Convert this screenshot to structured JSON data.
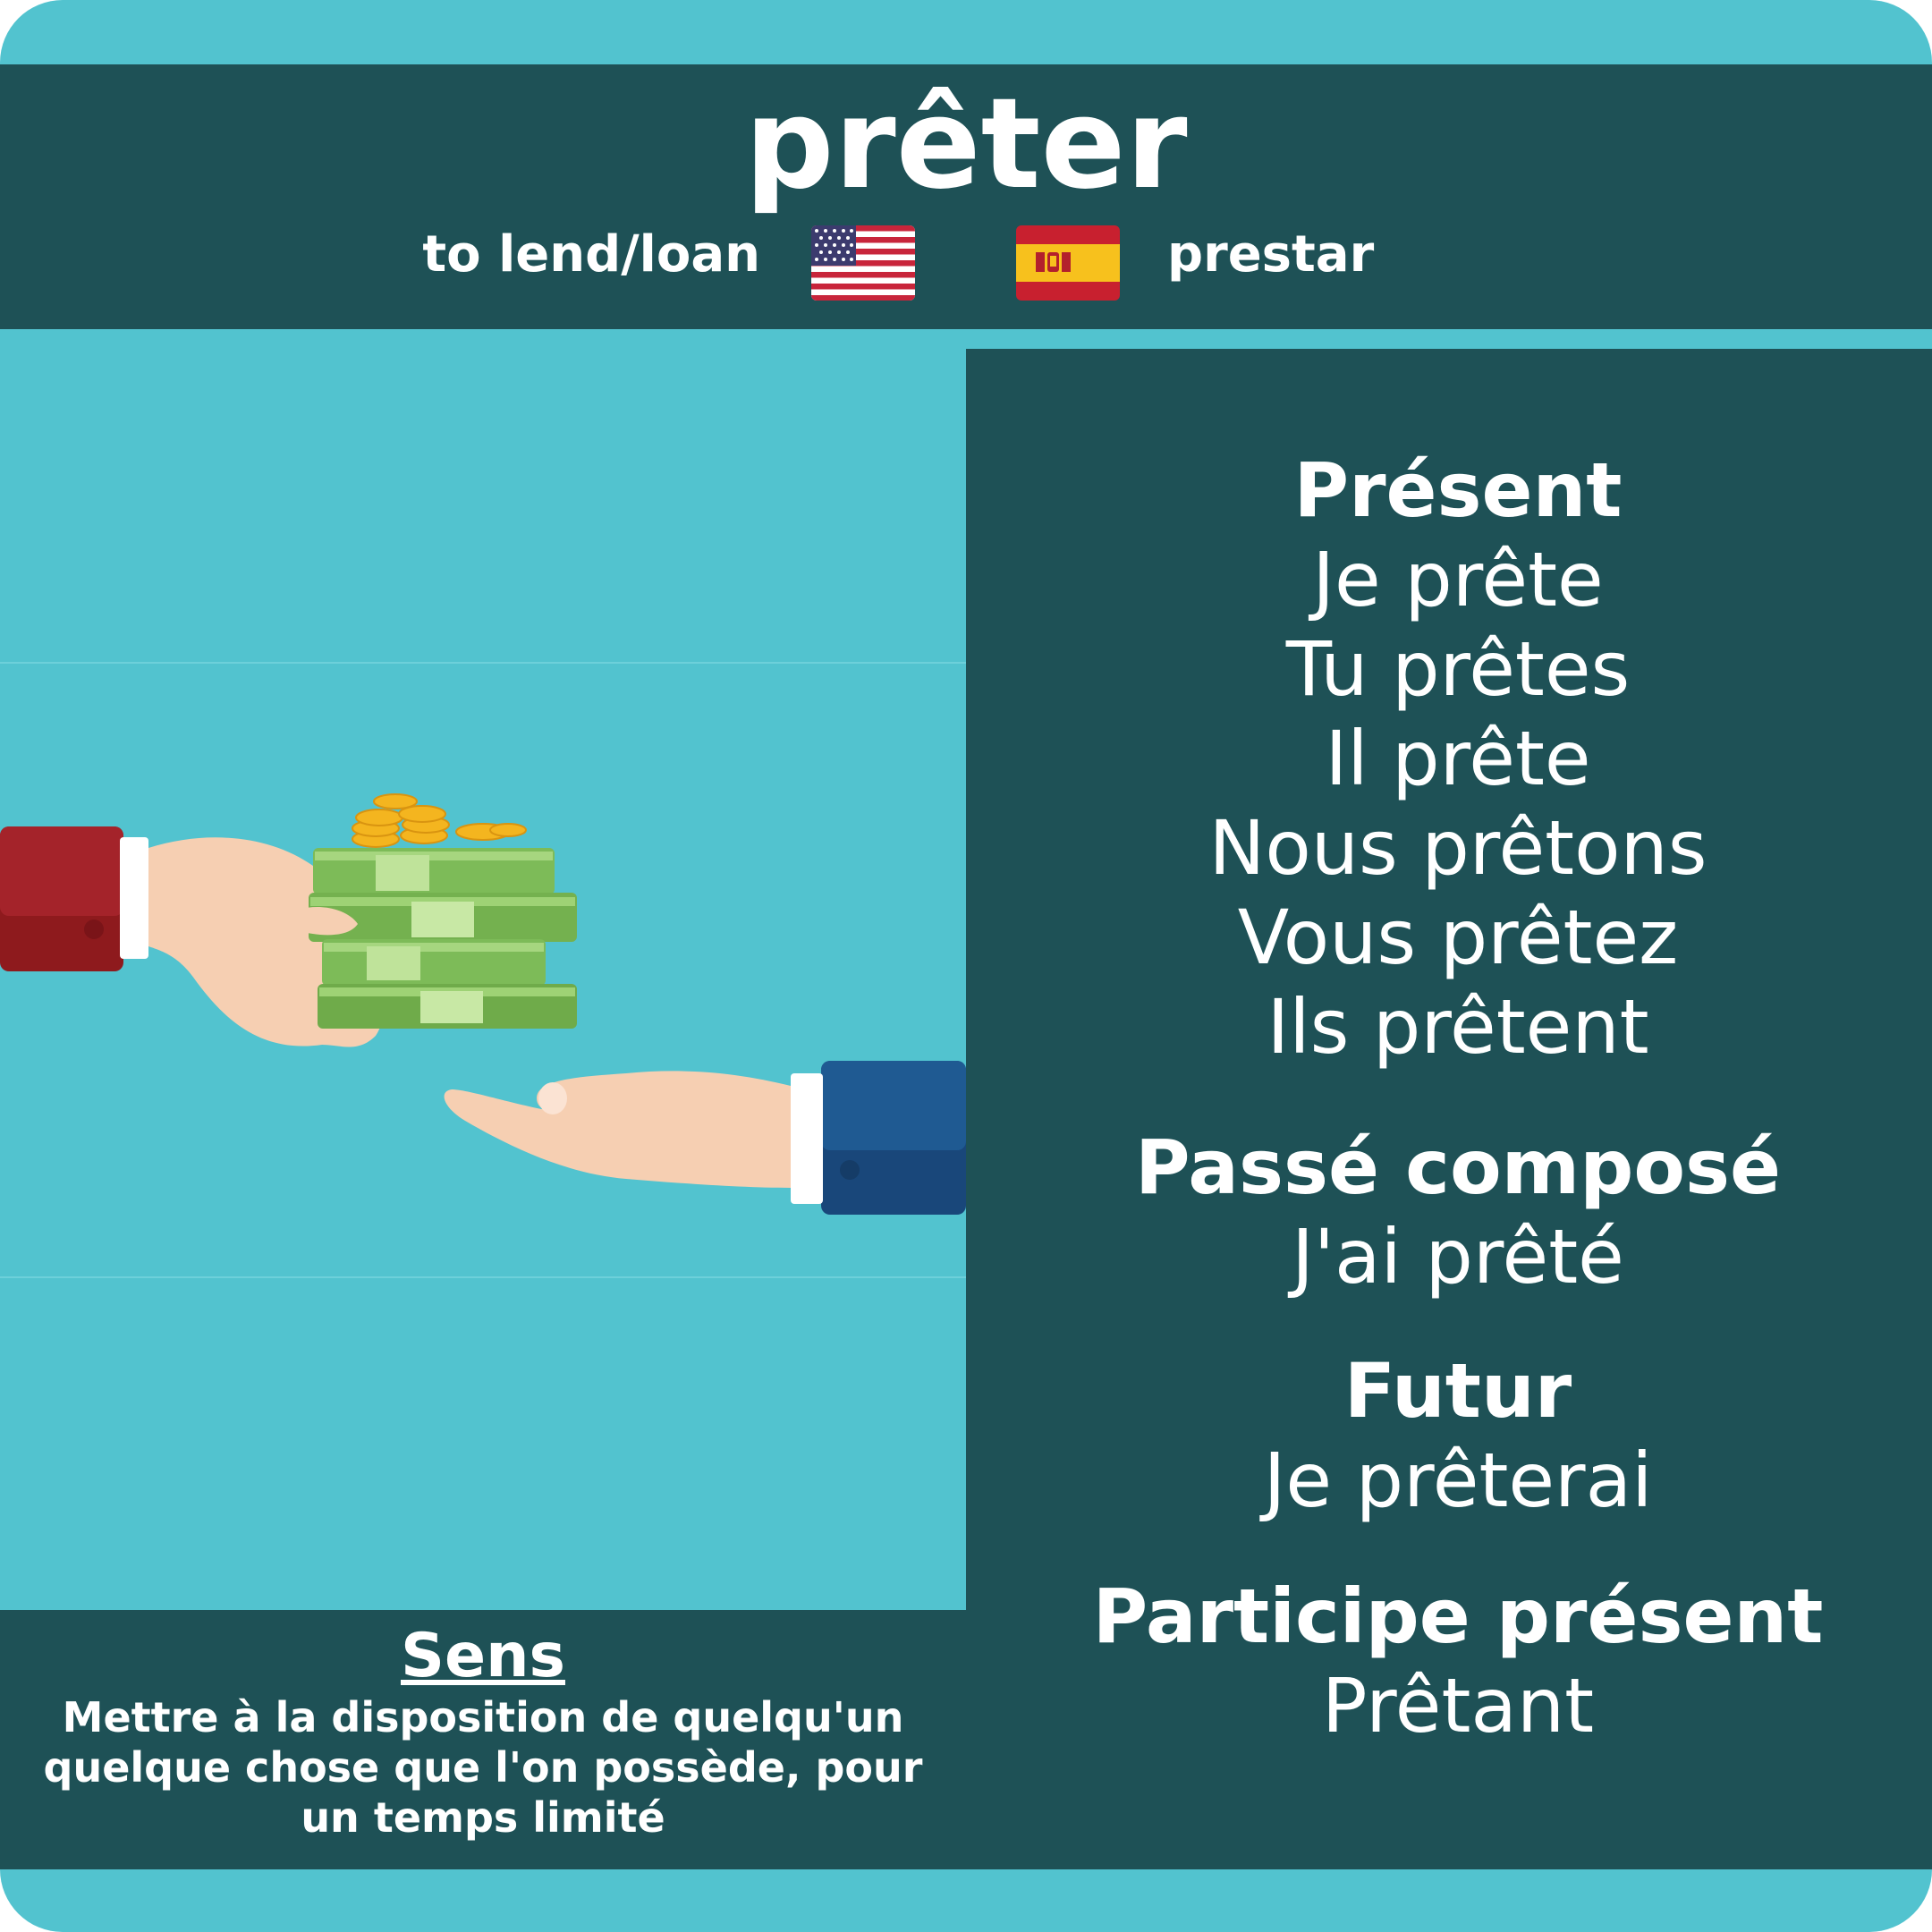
{
  "verb": "prêter",
  "translations": {
    "english": "to lend/loan",
    "spanish": "prestar",
    "english_flag_icon": "us-flag-icon",
    "spanish_flag_icon": "spain-flag-icon"
  },
  "colors": {
    "background": "#52c3cf",
    "panel": "#1e5156",
    "text": "#ffffff"
  },
  "conjugation": {
    "present": {
      "heading": "Présent",
      "forms": [
        "Je prête",
        "Tu prêtes",
        "Il prête",
        "Nous prêtons",
        "Vous prêtez",
        "Ils prêtent"
      ]
    },
    "passe_compose": {
      "heading": "Passé composé",
      "form": "J'ai prêté"
    },
    "futur": {
      "heading": "Futur",
      "form": "Je prêterai"
    },
    "participe_present": {
      "heading": "Participe présent",
      "form": "Prêtant"
    }
  },
  "sens": {
    "title": "Sens",
    "definition": "Mettre à la disposition de quelqu'un quelque chose que l'on possède, pour un temps limité"
  },
  "illustration": {
    "icon": "money-handover-illustration"
  }
}
